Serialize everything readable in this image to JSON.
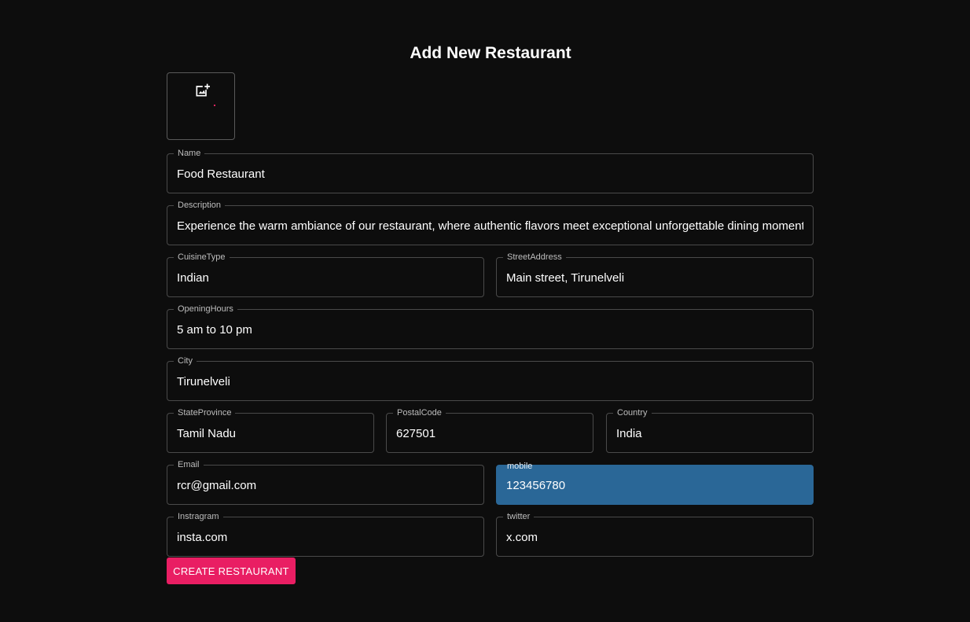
{
  "page": {
    "title": "Add New Restaurant"
  },
  "upload": {
    "icon": "add-photo-icon"
  },
  "fields": {
    "name": {
      "label": "Name",
      "value": "Food Restaurant"
    },
    "description": {
      "label": "Description",
      "value": "Experience the warm ambiance of our restaurant, where authentic flavors meet exceptional unforgettable dining moments."
    },
    "cuisine_type": {
      "label": "CuisineType",
      "value": "Indian"
    },
    "street_address": {
      "label": "StreetAddress",
      "value": "Main street, Tirunelveli"
    },
    "opening_hours": {
      "label": "OpeningHours",
      "value": "5 am to 10 pm"
    },
    "city": {
      "label": "City",
      "value": "Tirunelveli"
    },
    "state_province": {
      "label": "StateProvince",
      "value": "Tamil Nadu"
    },
    "postal_code": {
      "label": "PostalCode",
      "value": "627501"
    },
    "country": {
      "label": "Country",
      "value": "India"
    },
    "email": {
      "label": "Email",
      "value": "rcr@gmail.com"
    },
    "mobile": {
      "label": "mobile",
      "value": "123456780"
    },
    "instagram": {
      "label": "Instragram",
      "value": "insta.com"
    },
    "twitter": {
      "label": "twitter",
      "value": "x.com"
    }
  },
  "actions": {
    "submit_label": "CREATE RESTAURANT"
  },
  "colors": {
    "background": "#0d0d0d",
    "accent": "#e91e63",
    "autofill": "#2a6797",
    "border": "#4a4a4a"
  }
}
